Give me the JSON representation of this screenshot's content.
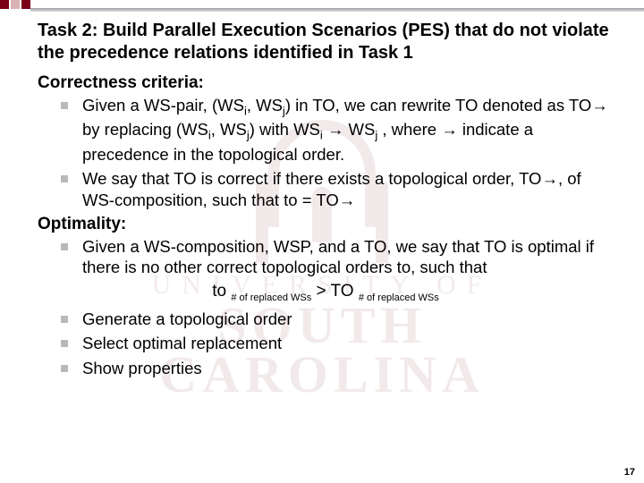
{
  "title": "Task 2: Build Parallel Execution Scenarios (PES) that do not violate the precedence relations identified in Task 1",
  "section1": "Correctness criteria:",
  "bullet1_pre": "Given a WS-pair, (WS",
  "bullet1_i": "i",
  "bullet1_mid1": ", WS",
  "bullet1_j": "j",
  "bullet1_mid2": ") in TO, we can rewrite TO denoted as TO→ by replacing (WS",
  "bullet1_mid3": ", WS",
  "bullet1_mid4": ") with WS",
  "bullet1_arrow": " → WS",
  "bullet1_post": " , where → indicate a precedence in the topological order.",
  "bullet2": "We say that TO is correct if there exists a topological order, TO→, of WS-composition, such that  to = TO→",
  "section2": "Optimality:",
  "bullet3": "Given a WS-composition, WSP, and a TO, we say that TO is optimal if there is no other correct topological orders to, such that",
  "formula_to1": "to ",
  "formula_sub": "# of replaced WSs",
  "formula_gt": " > TO ",
  "bullet4": "Generate a topological order",
  "bullet5": "Select optimal replacement",
  "bullet6": "Show properties",
  "page": "17",
  "watermark_u": "UNIVERSITY OF",
  "watermark_s": "SOUTH",
  "watermark_c": "CAROLINA"
}
